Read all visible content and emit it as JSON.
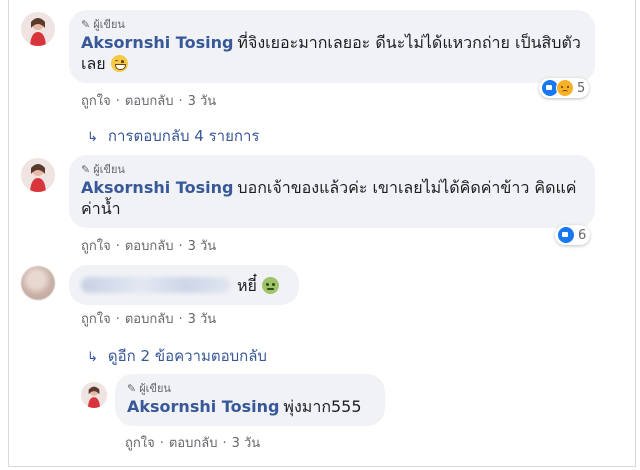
{
  "comments": [
    {
      "badge": "ผู้เขียน",
      "author": "Aksornshi Tosing",
      "text": "ที่จิงเยอะมากเลยอะ ดีนะไม่ได้แหวกถ่าย เป็นสิบตัวเลย",
      "emoji": "grinning-face-icon",
      "like_label": "ถูกใจ",
      "reply_label": "ตอบกลับ",
      "time": "3 วัน",
      "reactions": [
        "like",
        "sad"
      ],
      "reaction_count": "5",
      "replies_link": "การตอบกลับ 4 รายการ"
    },
    {
      "badge": "ผู้เขียน",
      "author": "Aksornshi Tosing",
      "text": "บอกเจ้าของแล้วค่ะ เขาเลยไม่ได้คิดค่าข้าว คิดแค่ค่าน้ำ",
      "like_label": "ถูกใจ",
      "reply_label": "ตอบกลับ",
      "time": "3 วัน",
      "reactions": [
        "like"
      ],
      "reaction_count": "6"
    },
    {
      "text": "หยี๋",
      "emoji": "nauseated-face-icon",
      "like_label": "ถูกใจ",
      "reply_label": "ตอบกลับ",
      "time": "3 วัน",
      "replies_link": "ดูอีก 2 ข้อความตอบกลับ"
    },
    {
      "badge": "ผู้เขียน",
      "author": "Aksornshi Tosing",
      "text": "พุ่งมาก555",
      "like_label": "ถูกใจ",
      "reply_label": "ตอบกลับ",
      "time": "3 วัน"
    }
  ],
  "colors": {
    "link": "#385898",
    "bubble": "#f0f2f5",
    "meta": "#65676b"
  }
}
